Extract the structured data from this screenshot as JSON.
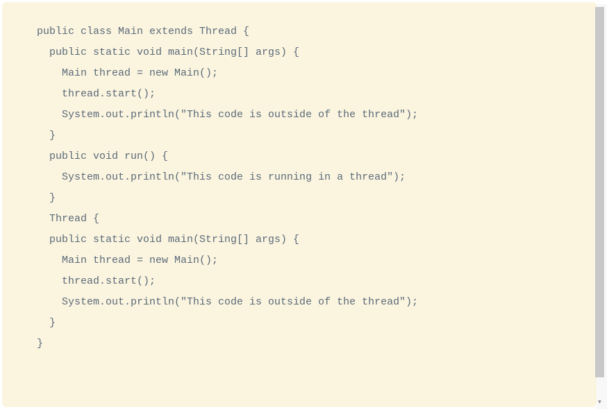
{
  "code": {
    "lines": [
      "public class Main extends Thread {",
      "  public static void main(String[] args) {",
      "    Main thread = new Main();",
      "    thread.start();",
      "    System.out.println(\"This code is outside of the thread\");",
      "  }",
      "  public void run() {",
      "    System.out.println(\"This code is running in a thread\");",
      "  }",
      "  Thread {",
      "  public static void main(String[] args) {",
      "    Main thread = new Main();",
      "    thread.start();",
      "    System.out.println(\"This code is outside of the thread\");",
      "  }",
      "}"
    ]
  },
  "scrollbar": {
    "arrow_up": "▴",
    "arrow_down": "▾"
  }
}
